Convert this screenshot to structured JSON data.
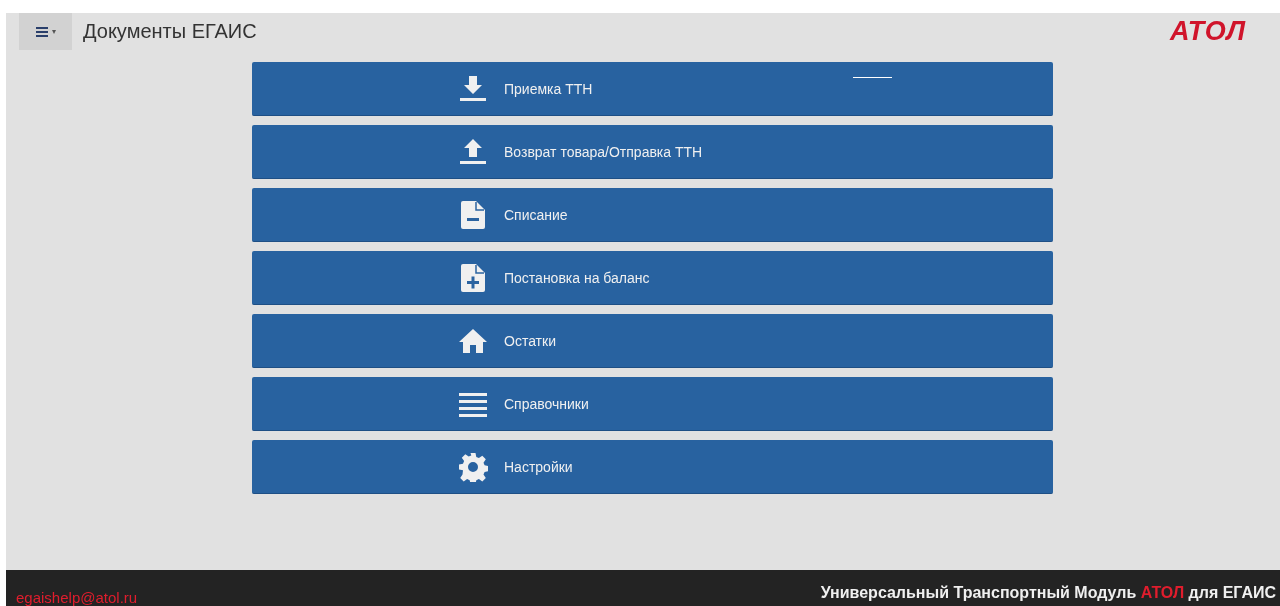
{
  "header": {
    "menu_button": {
      "caret": "▾"
    },
    "title": "Документы ЕГАИС",
    "logo": "АТОЛ"
  },
  "menu": [
    {
      "label": "Приемка ТТН",
      "kind": "download"
    },
    {
      "label": "Возврат товара/Отправка ТТН",
      "kind": "upload"
    },
    {
      "label": "Списание",
      "kind": "writeoff"
    },
    {
      "label": "Постановка на баланс",
      "kind": "register"
    },
    {
      "label": "Остатки",
      "kind": "stock"
    },
    {
      "label": "Справочники",
      "kind": "catalog"
    },
    {
      "label": "Настройки",
      "kind": "settings"
    }
  ],
  "footer": {
    "email": "egaishelp@atol.ru",
    "title_parts": [
      {
        "text": "Универсальный Транспортный Модуль ",
        "kind": "plain"
      },
      {
        "text": "АТОЛ",
        "kind": "brand"
      },
      {
        "text": " для ЕГАИС",
        "kind": "plain"
      }
    ]
  }
}
